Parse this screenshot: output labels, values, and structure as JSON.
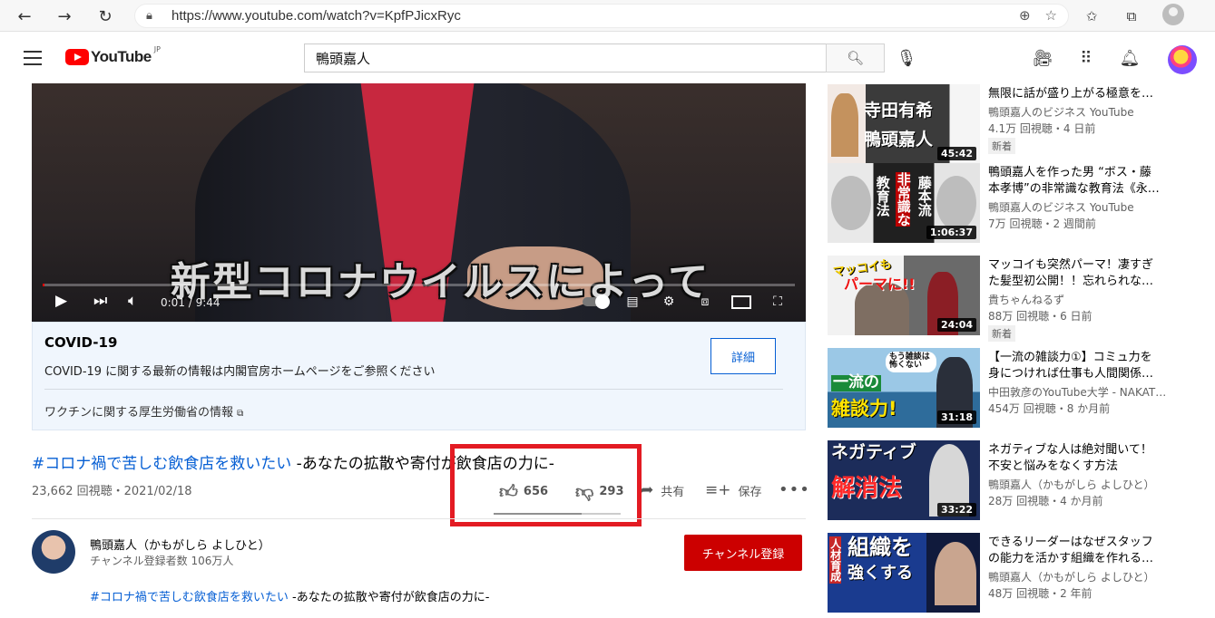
{
  "browser": {
    "url": "https://www.youtube.com/watch?v=KpfPJicxRyc"
  },
  "header": {
    "logo_text": "YouTube",
    "logo_region": "JP",
    "search_query": "鴨頭嘉人"
  },
  "player": {
    "subtitle": "新型コロナウイルスによって",
    "time": "0:01 / 9:44",
    "progress": 0.002
  },
  "covid_panel": {
    "title": "COVID-19",
    "description": "COVID-19 に関する最新の情報は内閣官房ホームページをご参照ください",
    "button_label": "詳細",
    "link_text": "ワクチンに関する厚生労働省の情報"
  },
  "video_info": {
    "title_tag": "#コロナ禍で苦しむ飲食店を救いたい",
    "title_rest": " -あなたの拡散や寄付が飲食店の力に-",
    "stats": "23,662 回視聴・2021/02/18",
    "likes": "656",
    "dislikes": "293",
    "like_ratio": 0.69,
    "share_label": "共有",
    "save_label": "保存"
  },
  "channel": {
    "name": "鴨頭嘉人（かもがしら よしひと）",
    "subscribers": "チャンネル登録者数 106万人",
    "subscribe_label": "チャンネル登録",
    "desc_tag": "#コロナ禍で苦しむ飲食店を救いたい",
    "desc_rest": " -あなたの拡散や寄付が飲食店の力に-"
  },
  "recommendations": [
    {
      "title1": "無限に話が盛り上がる極意を…",
      "title2": "",
      "channel": "鴨頭嘉人のビジネス YouTube",
      "meta": "4.1万 回視聴・4 日前",
      "badge": "新着",
      "duration": "45:42",
      "thumb_text": [
        "寺田有希",
        "鴨頭嘉人"
      ]
    },
    {
      "title1": "鴨頭嘉人を作った男 “ボス・藤",
      "title2": "本孝博”の非常識な教育法《永…",
      "channel": "鴨頭嘉人のビジネス YouTube",
      "meta": "7万 回視聴・2 週間前",
      "badge": "",
      "duration": "1:06:37",
      "thumb_text": [
        "教育法",
        "非常識な",
        "藤本流"
      ]
    },
    {
      "title1": "マッコイも突然パーマ！凄すぎ",
      "title2": "た髪型初公開！！忘れられな…",
      "channel": "貴ちゃんねるず",
      "meta": "88万 回視聴・6 日前",
      "badge": "新着",
      "duration": "24:04",
      "thumb_text": [
        "マッコイも",
        "パーマに!!"
      ]
    },
    {
      "title1": "【一流の雑談力①】コミュ力を",
      "title2": "身につければ仕事も人間関係…",
      "channel": "中田敦彦のYouTube大学 - NAKAT…",
      "meta": "454万 回視聴・8 か月前",
      "badge": "",
      "duration": "31:18",
      "thumb_text": [
        "一流の",
        "雑談力!",
        "もう雑談は怖くない"
      ]
    },
    {
      "title1": "ネガティブな人は絶対聞いて！",
      "title2": "不安と悩みをなくす方法",
      "channel": "鴨頭嘉人（かもがしら よしひと）",
      "meta": "28万 回視聴・4 か月前",
      "badge": "",
      "duration": "33:22",
      "thumb_text": [
        "ネガティブ",
        "解消法"
      ]
    },
    {
      "title1": "できるリーダーはなぜスタッフ",
      "title2": "の能力を活かす組織を作れる…",
      "channel": "鴨頭嘉人（かもがしら よしひと）",
      "meta": "48万 回視聴・2 年前",
      "badge": "",
      "duration": "",
      "thumb_text": [
        "組織を",
        "強くする",
        "人材育成"
      ]
    }
  ]
}
